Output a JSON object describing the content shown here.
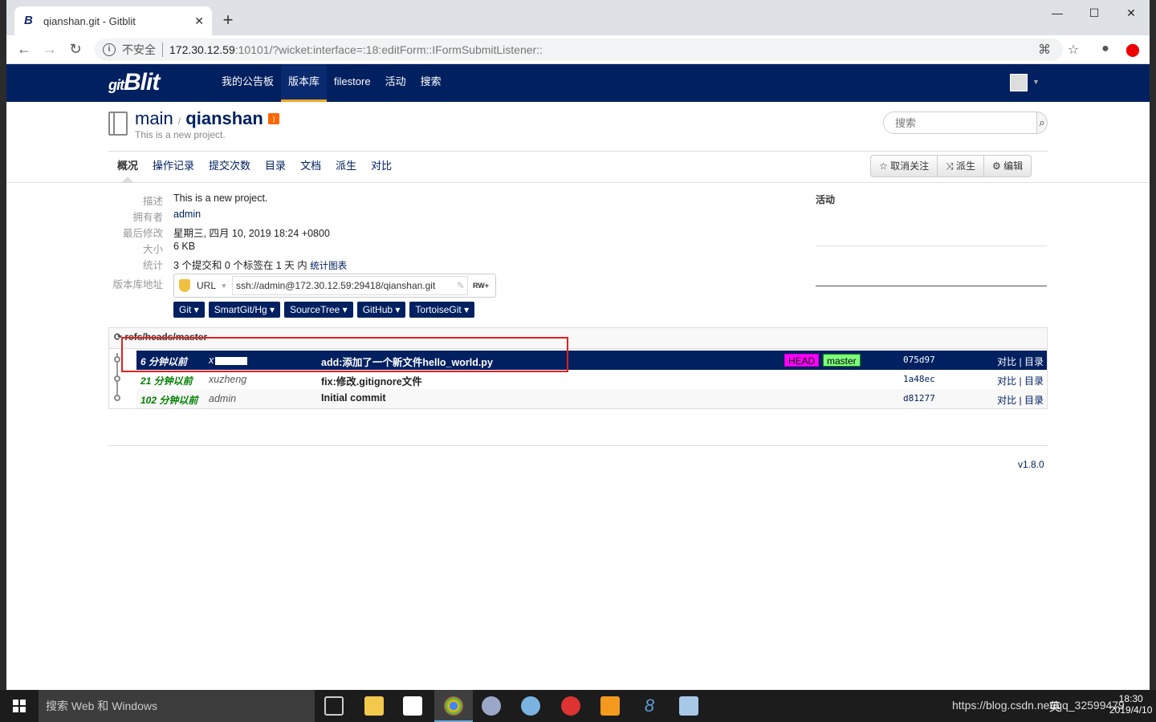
{
  "browser": {
    "tab_title": "qianshan.git - Gitblit",
    "tab_favicon": "B",
    "insecure_label": "不安全",
    "url_host": "172.30.12.59",
    "url_path": ":10101/?wicket:interface=:18:editForm::IFormSubmitListener::"
  },
  "gitblit": {
    "logo": "Blit",
    "nav": [
      "我的公告板",
      "版本库",
      "filestore",
      "活动",
      "搜索"
    ],
    "active_nav": "版本库"
  },
  "repo": {
    "project": "main",
    "separator": "/",
    "name": "qianshan",
    "description": "This is a new project.",
    "search_placeholder": "搜索",
    "tabs": [
      "概况",
      "操作记录",
      "提交次数",
      "目录",
      "文档",
      "派生",
      "对比"
    ],
    "active_tab": "概况",
    "actions": [
      "☆ 取消关注",
      "⤨ 派生",
      "⚙ 编辑"
    ]
  },
  "summary": {
    "labels": {
      "desc": "描述",
      "owner": "拥有者",
      "modified": "最后修改",
      "size": "大小",
      "stats": "统计",
      "url": "版本库地址"
    },
    "desc": "This is a new project.",
    "owner": "admin",
    "modified": "星期三, 四月 10, 2019 18:24 +0800",
    "size": "6 KB",
    "stats": "3 个提交和 0 个标签在 1 天 内",
    "stats_link": "统计图表",
    "url_proto": "URL",
    "clone_url": "ssh://admin@172.30.12.59:29418/qianshan.git",
    "access": "RW+",
    "clone_apps": [
      "Git ▾",
      "SmartGit/Hg ▾",
      "SourceTree ▾",
      "GitHub ▾",
      "TortoiseGit ▾"
    ]
  },
  "activity": {
    "title": "活动"
  },
  "log": {
    "ref": "refs/heads/master",
    "rows": [
      {
        "when": "6 分钟以前",
        "who": "x",
        "msg": "add:添加了一个新文件hello_world.py",
        "hash": "075d97",
        "compare": "对比",
        "tree": "目录",
        "sep": "|"
      },
      {
        "when": "21 分钟以前",
        "who": "xuzheng",
        "msg": "fix:修改.gitignore文件",
        "hash": "1a48ec",
        "compare": "对比",
        "tree": "目录",
        "sep": "|"
      },
      {
        "when": "102 分钟以前",
        "who": "admin",
        "msg": "Initial commit",
        "hash": "d81277",
        "compare": "对比",
        "tree": "目录",
        "sep": "|"
      }
    ],
    "tag_head": "HEAD",
    "tag_master": "master"
  },
  "footer": {
    "version": "v1.8.0"
  },
  "taskbar": {
    "search_text": "搜索 Web 和 Windows",
    "tray_text": "https://blog.csdn.net/qq_32599479",
    "ime": "英",
    "time": "18:30",
    "date": "2019/4/10"
  },
  "colors": {
    "nav_bg": "#002060",
    "accent": "#f5a623",
    "head_tag": "#ff00ff",
    "master_tag": "#7fff7f",
    "highlight": "#e02020"
  }
}
